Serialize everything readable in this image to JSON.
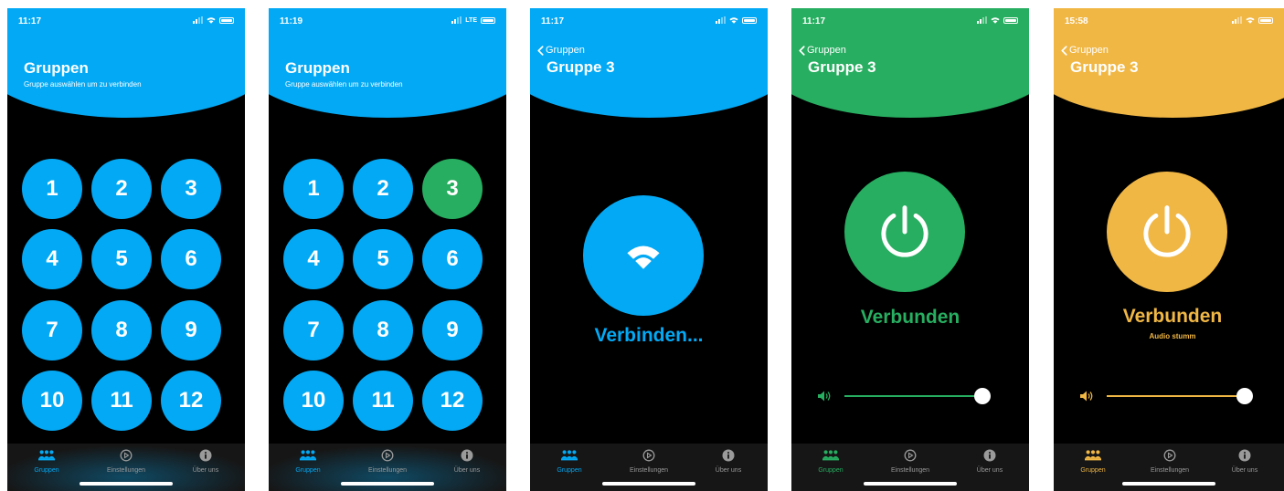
{
  "colors": {
    "blue": "#03a9f4",
    "green": "#27ae60",
    "yellow": "#f0b745",
    "tab_inactive": "#9a9a9a"
  },
  "tabs": {
    "groups": "Gruppen",
    "settings": "Einstellungen",
    "about": "Über uns"
  },
  "screens": [
    {
      "time": "11:17",
      "network": "",
      "title": "Gruppen",
      "subtitle": "Gruppe auswählen um zu verbinden",
      "numbers": [
        "1",
        "2",
        "3",
        "4",
        "5",
        "6",
        "7",
        "8",
        "9",
        "10",
        "11",
        "12"
      ],
      "selected": ""
    },
    {
      "time": "11:19",
      "network": "LTE",
      "title": "Gruppen",
      "subtitle": "Gruppe auswählen um zu verbinden",
      "numbers": [
        "1",
        "2",
        "3",
        "4",
        "5",
        "6",
        "7",
        "8",
        "9",
        "10",
        "11",
        "12"
      ],
      "selected": "3"
    },
    {
      "time": "11:17",
      "back": "Gruppen",
      "title": "Gruppe 3",
      "icon": "wifi-icon",
      "status": "Verbinden..."
    },
    {
      "time": "11:17",
      "back": "Gruppen",
      "title": "Gruppe 3",
      "icon": "power-icon",
      "status": "Verbunden",
      "volume": 1.0
    },
    {
      "time": "15:58",
      "back": "Gruppen",
      "title": "Gruppe 3",
      "icon": "power-icon",
      "status": "Verbunden",
      "substatus": "Audio stumm",
      "volume": 1.0
    }
  ]
}
